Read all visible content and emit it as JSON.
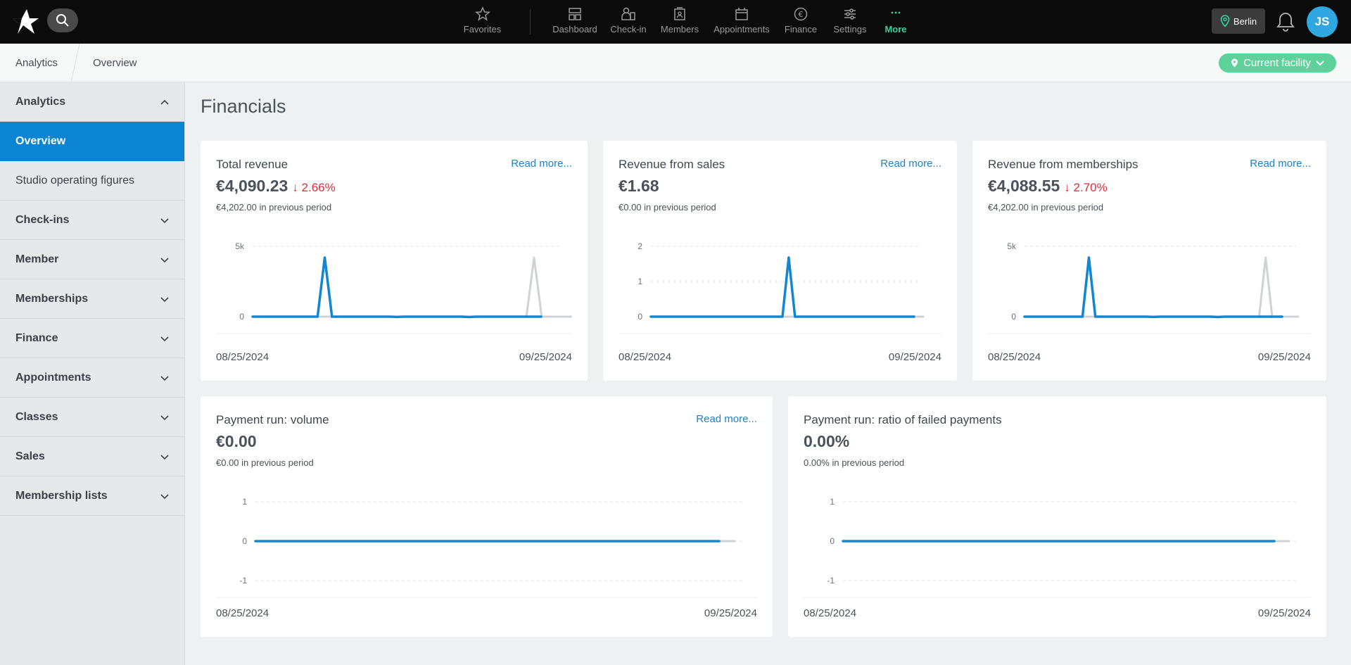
{
  "nav": {
    "items": [
      {
        "label": "Favorites",
        "icon": "star-icon"
      },
      {
        "label": "Dashboard",
        "icon": "dashboard-icon"
      },
      {
        "label": "Check-in",
        "icon": "check-in-icon"
      },
      {
        "label": "Members",
        "icon": "members-icon"
      },
      {
        "label": "Appointments",
        "icon": "calendar-icon"
      },
      {
        "label": "Finance",
        "icon": "euro-icon"
      },
      {
        "label": "Settings",
        "icon": "sliders-icon"
      },
      {
        "label": "More",
        "icon": "more-icon"
      }
    ],
    "location": "Berlin",
    "avatar_initials": "JS",
    "accent": "#35d3a4"
  },
  "breadcrumb": [
    "Analytics",
    "Overview"
  ],
  "facility_label": "Current facility",
  "sidebar": {
    "items": [
      {
        "label": "Analytics"
      },
      {
        "label": "Overview"
      },
      {
        "label": "Studio operating figures"
      },
      {
        "label": "Check-ins"
      },
      {
        "label": "Member"
      },
      {
        "label": "Memberships"
      },
      {
        "label": "Finance"
      },
      {
        "label": "Appointments"
      },
      {
        "label": "Classes"
      },
      {
        "label": "Sales"
      },
      {
        "label": "Membership lists"
      }
    ]
  },
  "page_title": "Financials",
  "cards": [
    {
      "title": "Total revenue",
      "link": "Read more...",
      "value": "€4,090.23",
      "delta": "↓ 2.66%",
      "previous": "€4,202.00 in previous period",
      "start_date": "08/25/2024",
      "end_date": "09/25/2024"
    },
    {
      "title": "Revenue from sales",
      "link": "Read more...",
      "value": "€1.68",
      "delta": "",
      "previous": "€0.00 in previous period",
      "start_date": "08/25/2024",
      "end_date": "09/25/2024"
    },
    {
      "title": "Revenue from memberships",
      "link": "Read more...",
      "value": "€4,088.55",
      "delta": "↓ 2.70%",
      "previous": "€4,202.00 in previous period",
      "start_date": "08/25/2024",
      "end_date": "09/25/2024"
    },
    {
      "title": "Payment run: volume",
      "link": "Read more...",
      "value": "€0.00",
      "delta": "",
      "previous": "€0.00 in previous period",
      "start_date": "08/25/2024",
      "end_date": "09/25/2024"
    },
    {
      "title": "Payment run: ratio of failed payments",
      "link": "",
      "value": "0.00%",
      "delta": "",
      "previous": "0.00% in previous period",
      "start_date": "08/25/2024",
      "end_date": "09/25/2024"
    }
  ],
  "colors": {
    "current": "#1486d1",
    "previous": "#cfd3d6",
    "delta_down": "#dd2d3c",
    "link": "#1b82cc"
  },
  "chart_data": [
    {
      "type": "line",
      "yticks": [
        "0",
        "5k"
      ],
      "ylim": [
        0,
        5000
      ],
      "series": [
        {
          "values": [
            0,
            0,
            0,
            0,
            0,
            0,
            0,
            0,
            0,
            0,
            4200,
            0,
            0,
            0,
            0,
            0,
            0,
            0,
            0,
            0,
            -20,
            0,
            0,
            0,
            0,
            0,
            0,
            0,
            0,
            0,
            -25,
            0,
            0,
            0,
            0,
            0,
            0,
            0,
            0,
            0,
            0
          ]
        },
        {
          "values": [
            0,
            0,
            0,
            0,
            0,
            0,
            0,
            0,
            0,
            0,
            0,
            0,
            0,
            0,
            0,
            0,
            0,
            0,
            0,
            0,
            0,
            0,
            0,
            0,
            0,
            0,
            0,
            0,
            0,
            0,
            0,
            0,
            0,
            0,
            0,
            0,
            0,
            4200,
            0,
            0,
            0,
            0,
            0
          ]
        }
      ]
    },
    {
      "type": "line",
      "yticks": [
        "0",
        "1",
        "2"
      ],
      "ylim": [
        0,
        2
      ],
      "series": [
        {
          "values": [
            0,
            0,
            0,
            0,
            0,
            0,
            0,
            0,
            0,
            0,
            0,
            0,
            0,
            0,
            0,
            0,
            0,
            0,
            0,
            0,
            0,
            0,
            1.68,
            0,
            0,
            0,
            0,
            0,
            0,
            0,
            0,
            0,
            0,
            0,
            0,
            0,
            0,
            0,
            0,
            0,
            0,
            0,
            0
          ]
        },
        {
          "values": [
            0,
            0,
            0,
            0,
            0,
            0,
            0,
            0,
            0,
            0,
            0,
            0,
            0,
            0,
            0,
            0,
            0,
            0,
            0,
            0,
            0,
            0,
            0,
            0,
            0,
            0,
            0,
            0,
            0,
            0,
            0,
            0,
            0,
            0,
            0,
            0,
            0,
            0,
            0,
            0,
            0,
            0,
            0,
            0
          ]
        }
      ]
    },
    {
      "type": "line",
      "yticks": [
        "0",
        "5k"
      ],
      "ylim": [
        0,
        5000
      ],
      "series": [
        {
          "values": [
            0,
            0,
            0,
            0,
            0,
            0,
            0,
            0,
            0,
            0,
            4200,
            0,
            0,
            0,
            0,
            0,
            0,
            0,
            0,
            0,
            -20,
            0,
            0,
            0,
            0,
            0,
            0,
            0,
            0,
            0,
            -25,
            0,
            0,
            0,
            0,
            0,
            0,
            0,
            0,
            0,
            0
          ]
        },
        {
          "values": [
            0,
            0,
            0,
            0,
            0,
            0,
            0,
            0,
            0,
            0,
            0,
            0,
            0,
            0,
            0,
            0,
            0,
            0,
            0,
            0,
            0,
            0,
            0,
            0,
            0,
            0,
            0,
            0,
            0,
            0,
            0,
            0,
            0,
            0,
            0,
            0,
            0,
            4200,
            0,
            0,
            0,
            0,
            0
          ]
        }
      ]
    },
    {
      "type": "line",
      "yticks": [
        "-1",
        "0",
        "1"
      ],
      "ylim": [
        -1,
        1
      ],
      "series": [
        {
          "values": [
            0,
            0,
            0,
            0,
            0,
            0,
            0,
            0,
            0,
            0,
            0,
            0,
            0,
            0,
            0,
            0,
            0,
            0,
            0,
            0,
            0,
            0,
            0,
            0,
            0,
            0,
            0,
            0,
            0,
            0,
            0
          ]
        },
        {
          "values": [
            0,
            0,
            0,
            0,
            0,
            0,
            0,
            0,
            0,
            0,
            0,
            0,
            0,
            0,
            0,
            0,
            0,
            0,
            0,
            0,
            0,
            0,
            0,
            0,
            0,
            0,
            0,
            0,
            0,
            0,
            0,
            0
          ]
        }
      ]
    },
    {
      "type": "line",
      "yticks": [
        "-1",
        "0",
        "1"
      ],
      "ylim": [
        -1,
        1
      ],
      "series": [
        {
          "values": [
            0,
            0,
            0,
            0,
            0,
            0,
            0,
            0,
            0,
            0,
            0,
            0,
            0,
            0,
            0,
            0,
            0,
            0,
            0,
            0,
            0,
            0,
            0,
            0,
            0,
            0,
            0,
            0,
            0,
            0,
            0
          ]
        },
        {
          "values": [
            0,
            0,
            0,
            0,
            0,
            0,
            0,
            0,
            0,
            0,
            0,
            0,
            0,
            0,
            0,
            0,
            0,
            0,
            0,
            0,
            0,
            0,
            0,
            0,
            0,
            0,
            0,
            0,
            0,
            0,
            0,
            0
          ]
        }
      ]
    }
  ]
}
